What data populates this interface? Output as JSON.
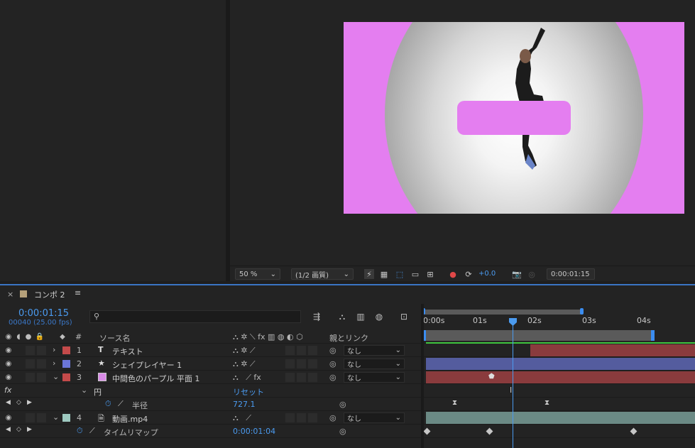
{
  "viewer": {
    "zoom": "50 %",
    "resolution": "(1/2 画質)",
    "exposure": "+0.0",
    "timecode": "0:00:01:15"
  },
  "timeline": {
    "comp_tab": "コンポ 2",
    "current_time": "0:00:01:15",
    "frame_info": "00040 (25.00 fps)",
    "search_placeholder": "",
    "ruler": [
      "0:00s",
      "01s",
      "02s",
      "03s",
      "04s"
    ],
    "headers": {
      "num": "#",
      "source_name": "ソース名",
      "parent_link": "親とリンク"
    },
    "layers": [
      {
        "num": "1",
        "name": "テキスト",
        "color": "#c44a4a",
        "parent": "なし",
        "icon": "text-layer-icon"
      },
      {
        "num": "2",
        "name": "シェイプレイヤー 1",
        "color": "#6b76d8",
        "parent": "なし",
        "icon": "shape-star-icon"
      },
      {
        "num": "3",
        "name": "中間色のパープル 平面 1",
        "color": "#c44a4a",
        "parent": "なし",
        "icon": "solid-swatch-icon"
      },
      {
        "num": "4",
        "name": "動画.mp4",
        "color": "#9ec9c0",
        "parent": "なし",
        "icon": "footage-file-icon"
      }
    ],
    "effect_row": {
      "name": "円",
      "reset": "リセット"
    },
    "radius_row": {
      "name": "半径",
      "value": "727.1"
    },
    "timeremap_row": {
      "name": "タイムリマップ",
      "value": "0:00:01:04"
    },
    "colors": {
      "accent": "#3a74c4",
      "playhead": "#4b9bf0",
      "bar_red": "#8a3b3d",
      "bar_blue": "#545c9e",
      "bar_teal": "#6b8a85",
      "work_area_green": "#3ec43e",
      "comp_bg": "#e47ef0"
    }
  }
}
